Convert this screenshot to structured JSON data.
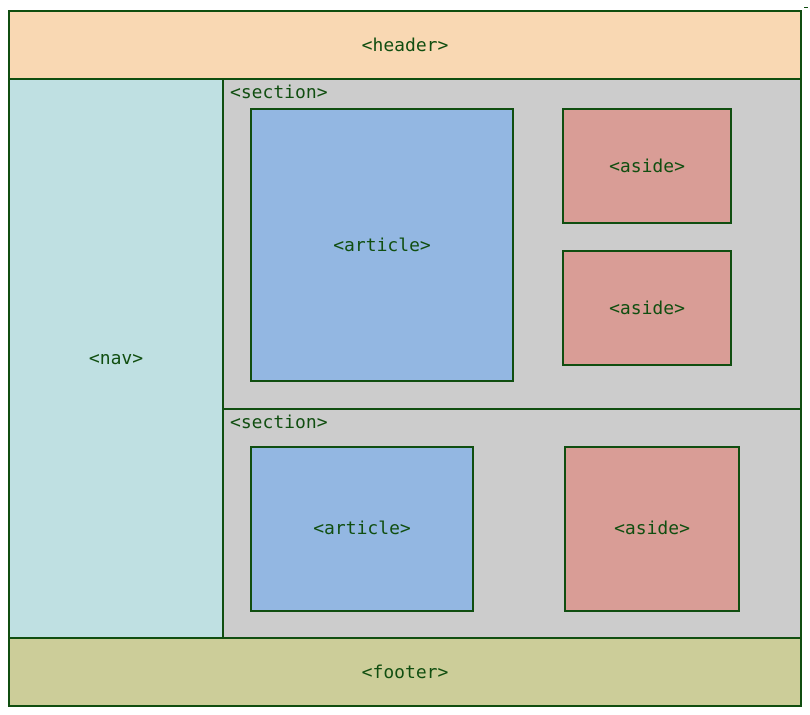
{
  "header": {
    "label": "<header>"
  },
  "nav": {
    "label": "<nav>"
  },
  "sections": [
    {
      "label": "<section>",
      "article": {
        "label": "<article>"
      },
      "asides": [
        {
          "label": "<aside>"
        },
        {
          "label": "<aside>"
        }
      ]
    },
    {
      "label": "<section>",
      "article": {
        "label": "<article>"
      },
      "asides": [
        {
          "label": "<aside>"
        }
      ]
    }
  ],
  "footer": {
    "label": "<footer>"
  },
  "colors": {
    "border": "#104e10",
    "header_bg": "#f9d8b3",
    "nav_bg": "#bfe0e2",
    "section_bg": "#cccccc",
    "article_bg": "#93b7e2",
    "aside_bg": "#d99d96",
    "footer_bg": "#cccd99"
  }
}
